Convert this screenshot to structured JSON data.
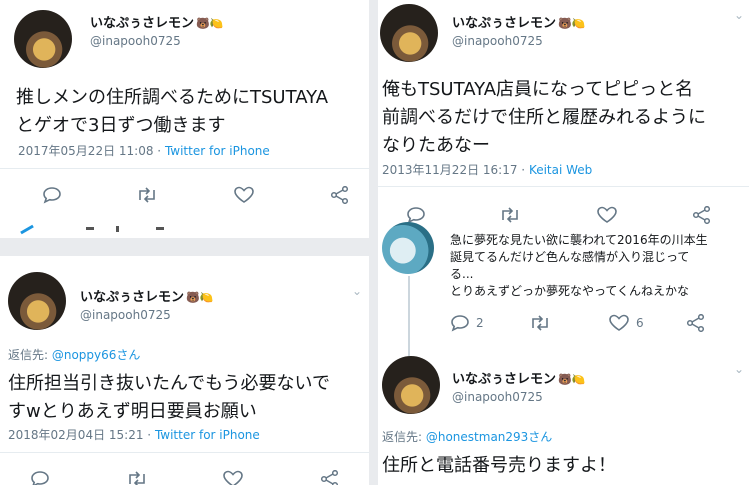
{
  "colors": {
    "link": "#1b95e0",
    "muted": "#657786",
    "text": "#14171a"
  },
  "tweets": [
    {
      "display_name": "いなぷぅさレモン",
      "emoji": "🐻🍋",
      "handle": "@inapooh0725",
      "text_lines": [
        "推しメンの住所調べるためにTSUTAYA",
        "とゲオで3日ずつ働きます"
      ],
      "date": "2017年05月22日 11:08",
      "sep": " · ",
      "source": "Twitter for iPhone"
    },
    {
      "display_name": "いなぷぅさレモン",
      "emoji": "🐻🍋",
      "handle": "@inapooh0725",
      "reply_prefix": "返信先: ",
      "reply_to": "@noppy66さん",
      "text_lines": [
        "住所担当引き抜いたんでもう必要ないで",
        "すwとりあえず明日要員お願い"
      ],
      "date": "2018年02月04日 15:21",
      "sep": " · ",
      "source": "Twitter for iPhone"
    },
    {
      "display_name": "いなぷぅさレモン",
      "emoji": "🐻🍋",
      "handle": "@inapooh0725",
      "text_lines": [
        "俺もTSUTAYA店員になってピピっと名",
        "前調べるだけで住所と履歴みれるように",
        "なりたあなー"
      ],
      "date": "2013年11月22日 16:17",
      "sep": " · ",
      "source": "Keitai Web"
    },
    {
      "text_lines": [
        "急に夢死な見たい欲に襲われて2016年の川本生",
        "誕見てるんだけど色んな感情が入り混じって",
        "る...",
        "とりあえずどっか夢死なやってくんねえかな"
      ],
      "reply_count": "2",
      "like_count": "6"
    },
    {
      "display_name": "いなぷぅさレモン",
      "emoji": "🐻🍋",
      "handle": "@inapooh0725",
      "reply_prefix": "返信先: ",
      "reply_to": "@honestman293さん",
      "text_lines": [
        "住所と電話番号売りますよ！"
      ]
    }
  ]
}
